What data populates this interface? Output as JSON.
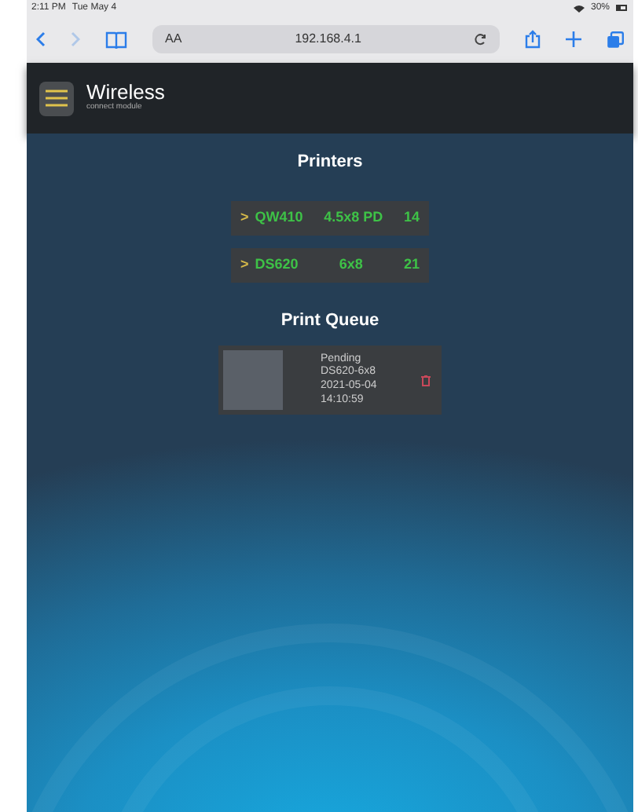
{
  "status_bar": {
    "time": "2:11 PM",
    "date": "Tue May 4",
    "battery": "30%"
  },
  "browser": {
    "text_size": "AA",
    "address": "192.168.4.1"
  },
  "app_header": {
    "logo_title": "Wireless",
    "logo_subtitle": "connect module"
  },
  "printers_section": {
    "title": "Printers",
    "printers": [
      {
        "expander": ">",
        "name": "QW410",
        "media": "4.5x8 PD",
        "count": "14"
      },
      {
        "expander": ">",
        "name": "DS620",
        "media": "6x8",
        "count": "21"
      }
    ]
  },
  "queue_section": {
    "title": "Print Queue",
    "jobs": [
      {
        "status": "Pending",
        "printer_media": "DS620-6x8",
        "date": "2021-05-04",
        "time": "14:10:59"
      }
    ]
  }
}
